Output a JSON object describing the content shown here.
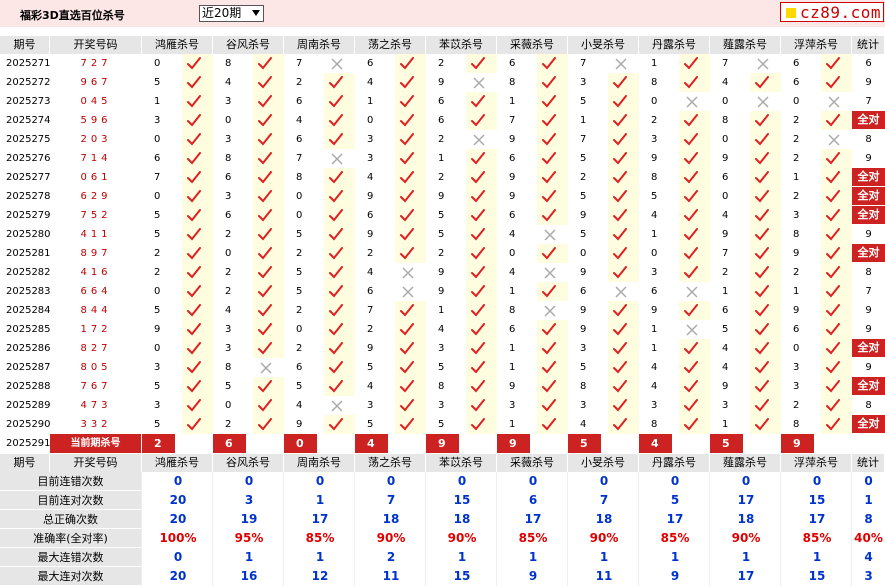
{
  "header": {
    "title": "福彩3D直选百位杀号",
    "period_select": "近20期",
    "logo": "cz89.com"
  },
  "columns": [
    "期号",
    "开奖号码",
    "鸿雁杀号",
    "谷风杀号",
    "周南杀号",
    "荡之杀号",
    "苯苡杀号",
    "采薇杀号",
    "小旻杀号",
    "丹露杀号",
    "薤露杀号",
    "浮萍杀号",
    "统计"
  ],
  "rows": [
    {
      "issue": "2025271",
      "num": "727",
      "preds": [
        0,
        8,
        7,
        6,
        2,
        6,
        7,
        1,
        7,
        6
      ],
      "stat": "6"
    },
    {
      "issue": "2025272",
      "num": "967",
      "preds": [
        5,
        4,
        2,
        4,
        9,
        8,
        3,
        8,
        4,
        6
      ],
      "stat": "9"
    },
    {
      "issue": "2025273",
      "num": "045",
      "preds": [
        1,
        3,
        6,
        1,
        6,
        1,
        5,
        0,
        0,
        0
      ],
      "stat": "7"
    },
    {
      "issue": "2025274",
      "num": "596",
      "preds": [
        3,
        0,
        4,
        0,
        6,
        7,
        1,
        2,
        8,
        2
      ],
      "stat": "全对"
    },
    {
      "issue": "2025275",
      "num": "203",
      "preds": [
        0,
        3,
        6,
        3,
        2,
        9,
        7,
        3,
        0,
        2
      ],
      "stat": "8"
    },
    {
      "issue": "2025276",
      "num": "714",
      "preds": [
        6,
        8,
        7,
        3,
        1,
        6,
        5,
        9,
        9,
        2
      ],
      "stat": "9"
    },
    {
      "issue": "2025277",
      "num": "061",
      "preds": [
        7,
        6,
        8,
        4,
        2,
        9,
        2,
        8,
        6,
        1
      ],
      "stat": "全对"
    },
    {
      "issue": "2025278",
      "num": "629",
      "preds": [
        0,
        3,
        0,
        9,
        9,
        9,
        5,
        5,
        0,
        2
      ],
      "stat": "全对"
    },
    {
      "issue": "2025279",
      "num": "752",
      "preds": [
        5,
        6,
        0,
        6,
        5,
        6,
        9,
        4,
        4,
        3
      ],
      "stat": "全对"
    },
    {
      "issue": "2025280",
      "num": "411",
      "preds": [
        5,
        2,
        5,
        9,
        5,
        4,
        5,
        1,
        9,
        8
      ],
      "stat": "9"
    },
    {
      "issue": "2025281",
      "num": "897",
      "preds": [
        2,
        0,
        2,
        2,
        2,
        0,
        0,
        0,
        7,
        9
      ],
      "stat": "全对"
    },
    {
      "issue": "2025282",
      "num": "416",
      "preds": [
        2,
        2,
        5,
        4,
        9,
        4,
        9,
        3,
        2,
        2
      ],
      "stat": "8"
    },
    {
      "issue": "2025283",
      "num": "664",
      "preds": [
        0,
        2,
        5,
        6,
        9,
        1,
        6,
        6,
        1,
        1
      ],
      "stat": "7"
    },
    {
      "issue": "2025284",
      "num": "844",
      "preds": [
        5,
        4,
        2,
        7,
        1,
        8,
        9,
        9,
        6,
        9
      ],
      "stat": "9"
    },
    {
      "issue": "2025285",
      "num": "172",
      "preds": [
        9,
        3,
        0,
        2,
        4,
        6,
        9,
        1,
        5,
        6
      ],
      "stat": "9"
    },
    {
      "issue": "2025286",
      "num": "827",
      "preds": [
        0,
        3,
        2,
        9,
        3,
        1,
        3,
        1,
        4,
        0
      ],
      "stat": "全对"
    },
    {
      "issue": "2025287",
      "num": "805",
      "preds": [
        3,
        8,
        6,
        5,
        5,
        1,
        5,
        4,
        4,
        3
      ],
      "stat": "9"
    },
    {
      "issue": "2025288",
      "num": "767",
      "preds": [
        5,
        5,
        5,
        4,
        8,
        9,
        8,
        4,
        9,
        3
      ],
      "stat": "全对"
    },
    {
      "issue": "2025289",
      "num": "473",
      "preds": [
        3,
        0,
        4,
        3,
        3,
        3,
        3,
        3,
        3,
        2
      ],
      "stat": "8"
    },
    {
      "issue": "2025290",
      "num": "332",
      "preds": [
        5,
        2,
        9,
        5,
        5,
        1,
        4,
        8,
        1,
        8
      ],
      "stat": "全对"
    }
  ],
  "current": {
    "issue": "2025291",
    "label": "当前期杀号",
    "preds": [
      2,
      6,
      0,
      4,
      9,
      9,
      5,
      4,
      5,
      9
    ]
  },
  "summary": [
    {
      "label": "目前连错次数",
      "values": [
        "0",
        "0",
        "0",
        "0",
        "0",
        "0",
        "0",
        "0",
        "0",
        "0",
        "0"
      ],
      "color": "blue"
    },
    {
      "label": "目前连对次数",
      "values": [
        "20",
        "3",
        "1",
        "7",
        "15",
        "6",
        "7",
        "5",
        "17",
        "15",
        "1"
      ],
      "color": "blue"
    },
    {
      "label": "总正确次数",
      "values": [
        "20",
        "19",
        "17",
        "18",
        "18",
        "17",
        "18",
        "17",
        "18",
        "17",
        "8"
      ],
      "color": "blue"
    },
    {
      "label": "准确率(全对率)",
      "values": [
        "100%",
        "95%",
        "85%",
        "90%",
        "90%",
        "85%",
        "90%",
        "85%",
        "90%",
        "85%",
        "40%"
      ],
      "color": "red"
    },
    {
      "label": "最大连错次数",
      "values": [
        "0",
        "1",
        "1",
        "2",
        "1",
        "1",
        "1",
        "1",
        "1",
        "1",
        "4"
      ],
      "color": "blue"
    },
    {
      "label": "最大连对次数",
      "values": [
        "20",
        "16",
        "12",
        "11",
        "15",
        "9",
        "11",
        "9",
        "17",
        "15",
        "3"
      ],
      "color": "blue"
    }
  ],
  "colors": {
    "check": "#e02020",
    "cross": "#aaaaaa",
    "header_bg": "#e6e6e6",
    "highlight": "#fffde0",
    "accent": "#cc2222"
  },
  "icons": {
    "hit": "check-icon",
    "miss": "cross-icon"
  }
}
